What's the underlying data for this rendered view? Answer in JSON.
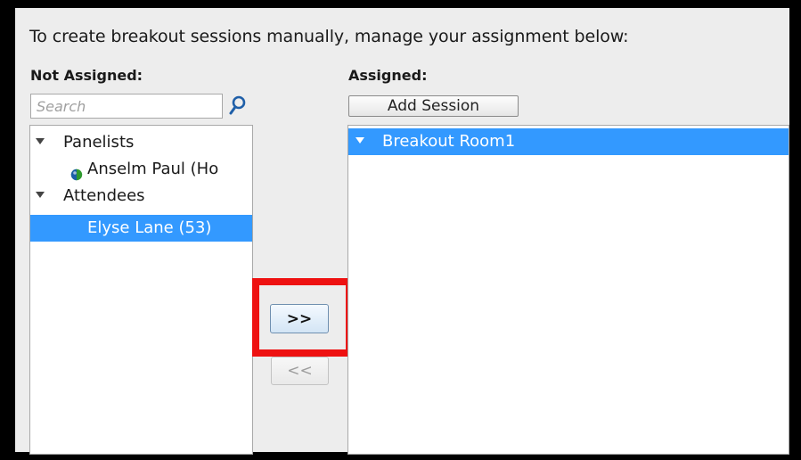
{
  "instruction": "To create breakout sessions manually, manage your assignment below:",
  "not_assigned": {
    "header": "Not Assigned:",
    "search_placeholder": "Search",
    "tree": {
      "panelists_label": "Panelists",
      "panelist_name": "Anselm Paul (Ho",
      "attendees_label": "Attendees",
      "attendee_name": "Elyse Lane (53)"
    }
  },
  "assigned": {
    "header": "Assigned:",
    "add_session_label": "Add Session",
    "rooms": [
      "Breakout Room1"
    ]
  },
  "controls": {
    "assign_label": ">>",
    "unassign_label": "<<"
  },
  "colors": {
    "selection": "#3399ff",
    "highlight": "#ee1111",
    "panelist_status_icon": "#2e9a2e"
  },
  "icons": {
    "search": "search-icon",
    "panelist_status": "presenter-status-icon",
    "expand": "expand-triangle-icon"
  }
}
